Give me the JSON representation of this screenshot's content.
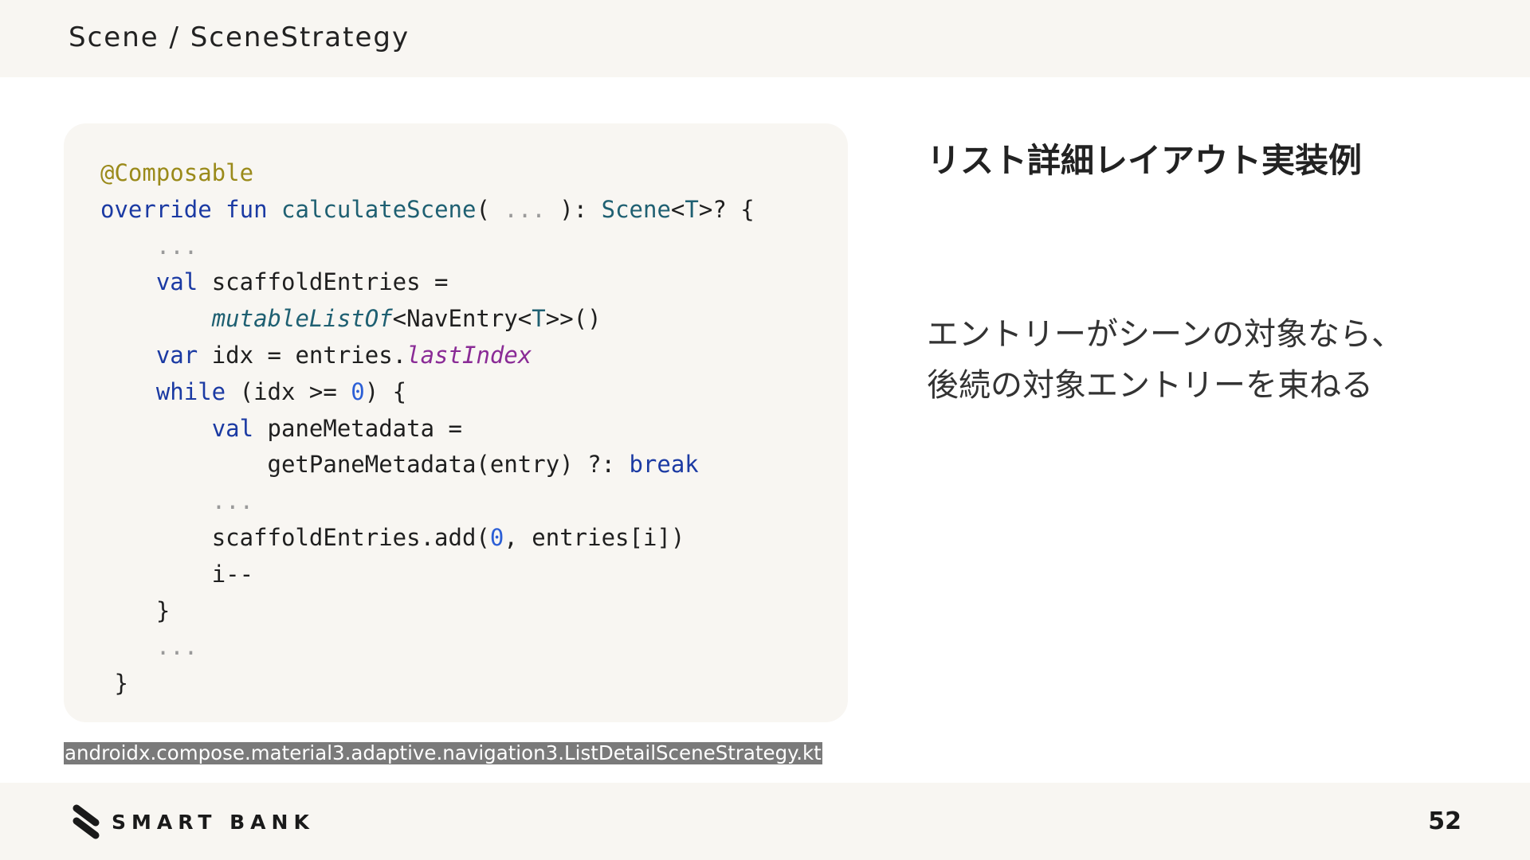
{
  "header": {
    "title": "Scene / SceneStrategy"
  },
  "code": {
    "l1_annotation": "@Composable",
    "l2_override": "override",
    "l2_fun": "fun",
    "l2_name": "calculateScene",
    "l2_open": "( ",
    "l2_ellipsis": "...",
    "l2_close": " ): ",
    "l2_type": "Scene",
    "l2_lt": "<",
    "l2_typeparam": "T",
    "l2_tail": ">? {",
    "l3_ellipsis": "...",
    "l4_val": "val",
    "l4_rest": " scaffoldEntries =",
    "l5_fn": "mutableListOf",
    "l5_mid": "<NavEntry<",
    "l5_typeparam": "T",
    "l5_tail": ">>()",
    "l6_var": "var",
    "l6_mid": " idx = entries.",
    "l6_prop": "lastIndex",
    "l7_while": "while",
    "l7_mid": " (idx >= ",
    "l7_num": "0",
    "l7_tail": ") {",
    "l8_val": "val",
    "l8_rest": " paneMetadata =",
    "l9_call": "getPaneMetadata(entry) ?: ",
    "l9_break": "break",
    "l10_ellipsis": "...",
    "l11_head": "scaffoldEntries.add(",
    "l11_num": "0",
    "l11_tail": ", entries[i])",
    "l12": "i--",
    "l13": "}",
    "l14_ellipsis": "...",
    "l15": "}"
  },
  "source_caption": "androidx.compose.material3.adaptive.navigation3.ListDetailSceneStrategy.kt",
  "content": {
    "heading": "リスト詳細レイアウト実装例",
    "description_lines": [
      "エントリーがシーンの対象なら、",
      "後続の対象エントリーを束ねる"
    ]
  },
  "footer": {
    "logo_text": "SMART BANK",
    "logo_icon": "smartbank-logo-icon",
    "page_number": "52"
  },
  "colors": {
    "panel_background": "#f8f6f2",
    "annotation": "#9a8a1a",
    "keyword": "#1b3aa3",
    "function": "#1f6072",
    "number": "#2c5fd6",
    "property": "#8a2b96",
    "caption_background": "#7a7a7a"
  }
}
